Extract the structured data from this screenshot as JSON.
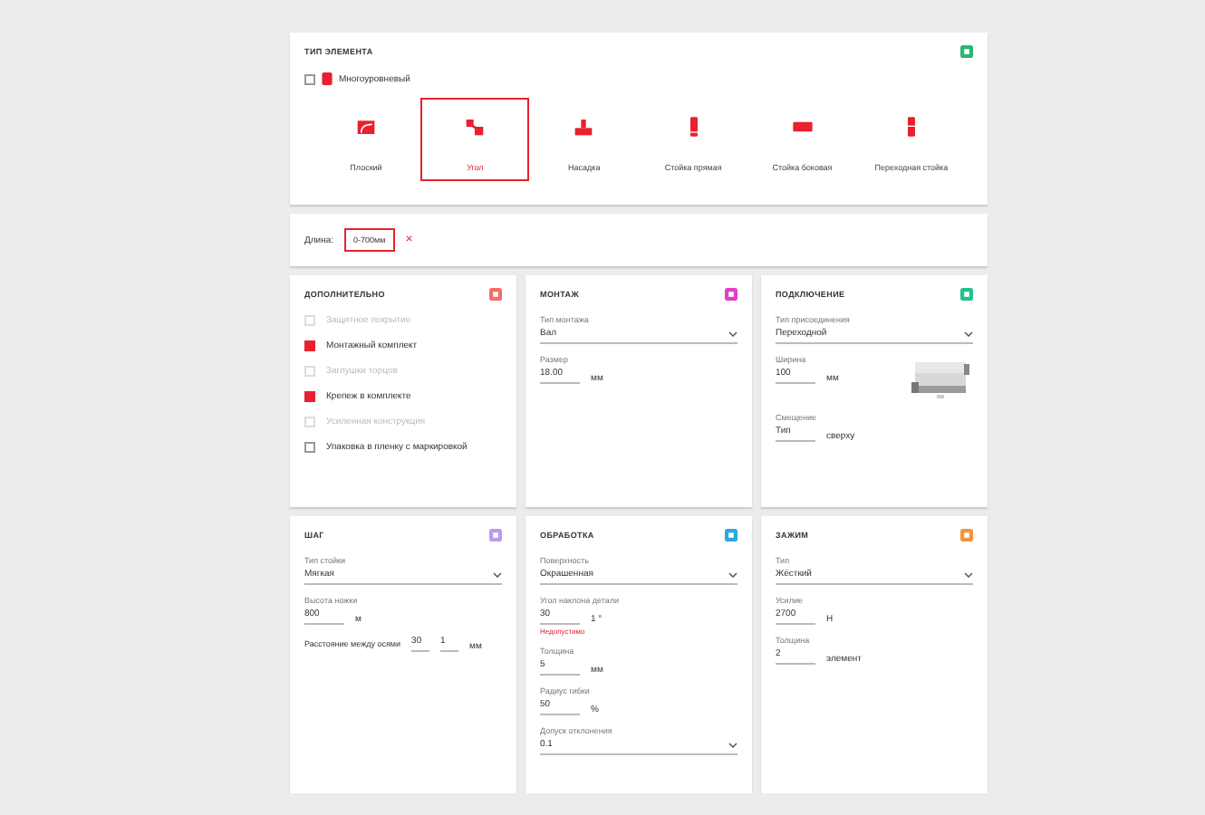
{
  "type_panel": {
    "title": "ТИП ЭЛЕМЕНТА",
    "color": "#2bb673",
    "multilevel": {
      "label": "Многоуровневый",
      "checked": false
    },
    "types": [
      {
        "label": "Плоский",
        "selected": false
      },
      {
        "label": "Угол",
        "selected": true
      },
      {
        "label": "Насадка",
        "selected": false
      },
      {
        "label": "Стойка прямая",
        "selected": false
      },
      {
        "label": "Стойка боковая",
        "selected": false
      },
      {
        "label": "Переходная стойка",
        "selected": false
      }
    ]
  },
  "filter": {
    "label": "Длина:",
    "chip": "0-700мм",
    "remove": "×"
  },
  "cards": [
    {
      "title": "ДОПОЛНИТЕЛЬНО",
      "color": "#f26d6d",
      "kind": "checklist",
      "items": [
        {
          "label": "Защитное покрытие",
          "checked": false,
          "disabled": true
        },
        {
          "label": "Монтажный комплект",
          "checked": true,
          "disabled": false
        },
        {
          "label": "Заглушки торцов",
          "checked": false,
          "disabled": true
        },
        {
          "label": "Крепеж в комплекте",
          "checked": true,
          "disabled": false
        },
        {
          "label": "Усиленная конструкция",
          "checked": false,
          "disabled": true
        },
        {
          "label": "Упаковка в пленку с маркировкой",
          "checked": false,
          "disabled": false
        }
      ]
    },
    {
      "title": "МОНТАЖ",
      "color": "#e040c8",
      "kind": "form",
      "fields": [
        {
          "kind": "select",
          "label": "Тип монтажа",
          "value": "Вал"
        },
        {
          "kind": "number",
          "label": "Размер",
          "value": "18.00",
          "unit": "мм"
        }
      ]
    },
    {
      "title": "ПОДКЛЮЧЕНИЕ",
      "color": "#1fc28a",
      "kind": "form",
      "fields": [
        {
          "kind": "select",
          "label": "Тип присоединения",
          "value": "Переходной"
        },
        {
          "kind": "number",
          "label": "Ширина",
          "value": "100",
          "unit": "мм"
        },
        {
          "kind": "number",
          "label": "Смещение",
          "value": "Тип",
          "unit": "сверху"
        }
      ]
    },
    {
      "title": "ШАГ",
      "color": "#b59cf0",
      "kind": "form",
      "fields": [
        {
          "kind": "select",
          "label": "Тип стойки",
          "value": "Мягкая"
        },
        {
          "kind": "number",
          "label": "Высота ножки",
          "value": "800",
          "unit": "м"
        },
        {
          "kind": "pair",
          "label": "Расстояние между осями",
          "values": [
            "30",
            "1"
          ],
          "unit": "мм"
        }
      ]
    },
    {
      "title": "ОБРАБОТКА",
      "color": "#2aa8e0",
      "kind": "form",
      "fields": [
        {
          "kind": "select",
          "label": "Поверхность",
          "value": "Окрашенная"
        },
        {
          "kind": "number",
          "label": "Угол наклона детали",
          "value": "30",
          "unit": "1 °",
          "error": "Недопустимо"
        },
        {
          "kind": "number",
          "label": "Толщина",
          "value": "5",
          "unit": "мм"
        },
        {
          "kind": "number",
          "label": "Радиус гибки",
          "value": "50",
          "unit": "%"
        },
        {
          "kind": "select",
          "label": "Допуск отклонения",
          "value": "0.1"
        }
      ]
    },
    {
      "title": "ЗАЖИМ",
      "color": "#f5923e",
      "kind": "form",
      "fields": [
        {
          "kind": "select",
          "label": "Тип",
          "value": "Жёсткий"
        },
        {
          "kind": "number",
          "label": "Усилие",
          "value": "2700",
          "unit": "Н"
        },
        {
          "kind": "number",
          "label": "Толщина",
          "value": "2",
          "unit": "элемент"
        }
      ]
    }
  ]
}
